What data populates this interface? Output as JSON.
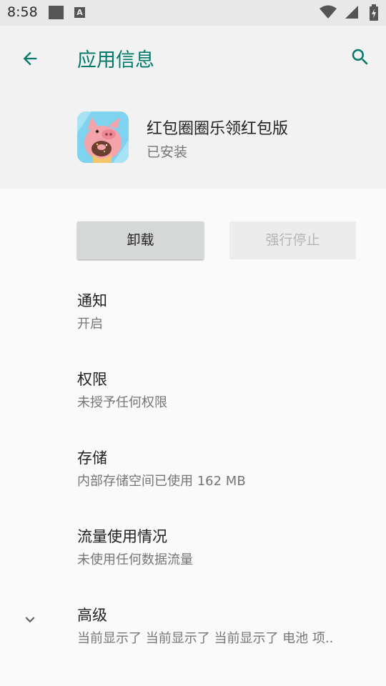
{
  "status_bar": {
    "time": "8:58",
    "notif_icon": "square-icon",
    "notif_icon2": "app-a-icon",
    "notif_icon2_letter": "A",
    "wifi_icon": "wifi-icon",
    "signal_icon": "signal-icon",
    "battery_icon": "battery-charging-icon"
  },
  "header": {
    "back_icon": "arrow-back-icon",
    "title": "应用信息",
    "search_icon": "search-icon",
    "accent_color": "#00796b"
  },
  "app": {
    "name": "红包圈圈乐领红包版",
    "status": "已安装",
    "icon": "pig-app-icon"
  },
  "buttons": {
    "uninstall": "卸载",
    "force_stop": "强行停止"
  },
  "preferences": [
    {
      "title": "通知",
      "summary": "开启"
    },
    {
      "title": "权限",
      "summary": "未授予任何权限"
    },
    {
      "title": "存储",
      "summary": "内部存储空间已使用 162 MB"
    },
    {
      "title": "流量使用情况",
      "summary": "未使用任何数据流量"
    },
    {
      "title": "高级",
      "summary": "当前显示了 当前显示了 当前显示了 电池 项..",
      "icon": "chevron-down-icon"
    }
  ]
}
